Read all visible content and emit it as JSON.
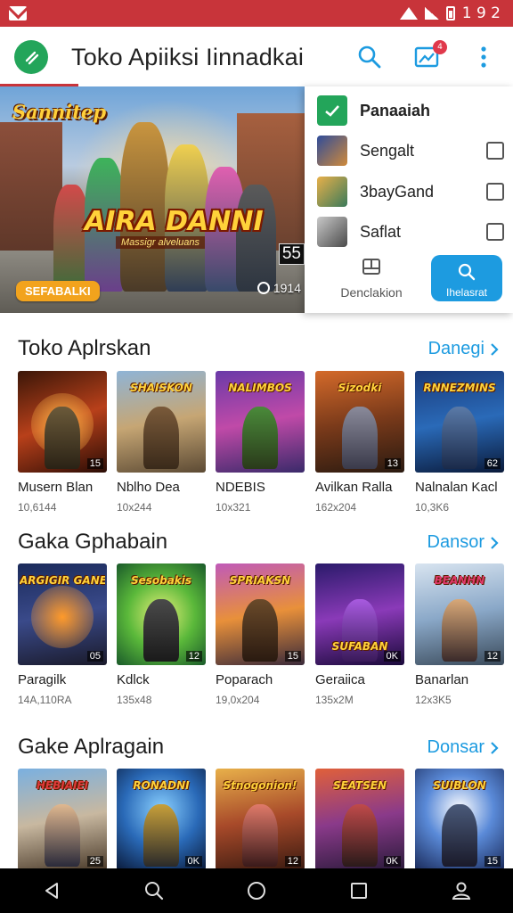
{
  "status_bar": {
    "time": "1 9 2"
  },
  "app_bar": {
    "title": "Toko Apiiksi  Iinnadkai",
    "notification_count": "4"
  },
  "banner": {
    "top_text": "Sannitep",
    "title": "AIRA DANNI",
    "subtitle": "Massigr alveluans",
    "cta": "SEFABALKI",
    "corner_badge": "55",
    "downloads": "1914"
  },
  "popup": {
    "items": [
      {
        "label": "Panaaiah",
        "bold": true,
        "checkbox": false
      },
      {
        "label": "Sengalt",
        "bold": false,
        "checkbox": true
      },
      {
        "label": "3bayGand",
        "bold": false,
        "checkbox": true
      },
      {
        "label": "Saflat",
        "bold": false,
        "checkbox": true
      }
    ],
    "left_action": "Denclakion",
    "right_action": "Ihelasrat"
  },
  "sections": [
    {
      "title": "Toko Aplrskan",
      "link": "Danegi",
      "cards": [
        {
          "thumb_title": "",
          "tag": "15",
          "name": "Musern Blan",
          "meta": "10,6144"
        },
        {
          "thumb_title": "SHAISKON",
          "tag": "",
          "name": "Nblho Dea",
          "meta": "10x244"
        },
        {
          "thumb_title": "NALIMBOS",
          "tag": "",
          "name": "NDEBIS",
          "meta": "10x321"
        },
        {
          "thumb_title": "Sizodki",
          "tag": "13",
          "name": "Avilkan Ralla",
          "meta": "162x204"
        },
        {
          "thumb_title": "RNNEZMINS",
          "tag": "62",
          "name": "Nalnalan Kacl",
          "meta": "10,3K6"
        }
      ]
    },
    {
      "title": "Gaka Gphabain",
      "link": "Dansor",
      "cards": [
        {
          "thumb_title": "ARGIGIR GANER",
          "tag": "05",
          "name": "Paragilk",
          "meta": "14A,110RA"
        },
        {
          "thumb_title": "Sesobakis",
          "tag": "12",
          "name": "Kdlck",
          "meta": "135x48"
        },
        {
          "thumb_title": "SPRIAKSN",
          "tag": "15",
          "name": "Poparach",
          "meta": "19,0x204"
        },
        {
          "thumb_title": "SUFABAN",
          "tag": "0K",
          "name": "Geraiica",
          "meta": "135x2M"
        },
        {
          "thumb_title": "BEANHN",
          "tag": "12",
          "name": "Banarlan",
          "meta": "12x3K5"
        }
      ]
    },
    {
      "title": "Gake Aplragain",
      "link": "Donsar",
      "cards": [
        {
          "thumb_title": "HEBIAIEI",
          "tag": "25",
          "name": "",
          "meta": ""
        },
        {
          "thumb_title": "RONADNI",
          "tag": "0K",
          "name": "",
          "meta": ""
        },
        {
          "thumb_title": "Stnogonion!",
          "tag": "12",
          "name": "",
          "meta": ""
        },
        {
          "thumb_title": "SEATSEN",
          "tag": "0K",
          "name": "",
          "meta": ""
        },
        {
          "thumb_title": "SUIBLON",
          "tag": "15",
          "name": "",
          "meta": ""
        }
      ]
    }
  ],
  "colors": {
    "status_bar": "#c8343a",
    "accent": "#1d9be0",
    "logo": "#23a55a",
    "nav_bar": "#000000"
  },
  "icons": {
    "status": [
      "gmail-icon",
      "wifi-icon",
      "signal-icon",
      "battery-icon"
    ],
    "app_bar": [
      "search-icon",
      "image-icon",
      "more-vert-icon"
    ],
    "nav": [
      "back-icon",
      "search-icon",
      "home-icon",
      "recents-icon",
      "profile-icon"
    ]
  }
}
